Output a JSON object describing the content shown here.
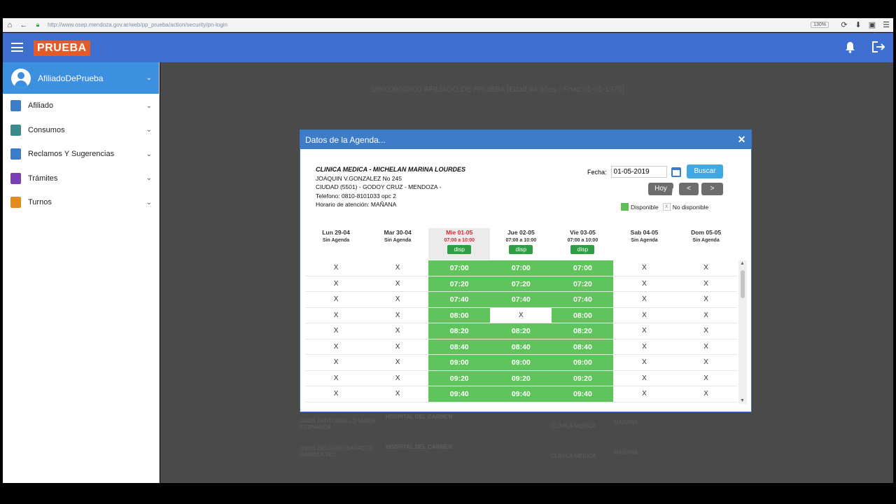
{
  "browser": {
    "url": "http://www.osep.mendoza.gov.ar/web/pp_prueba/action/security/pn-login",
    "zoom": "130%"
  },
  "header": {
    "brand": "PRUEBA"
  },
  "sidebar": {
    "user": "AfiliadoDePrueba",
    "items": [
      {
        "label": "Afiliado",
        "color": "#3d7cc9"
      },
      {
        "label": "Consumos",
        "color": "#3a8a8a"
      },
      {
        "label": "Reclamos Y Sugerencias",
        "color": "#3d7cc9"
      },
      {
        "label": "Trámites",
        "color": "#7b3fb5"
      },
      {
        "label": "Turnos",
        "color": "#e58a1f"
      }
    ]
  },
  "background": {
    "affiliate_line": "5/00000000/00 AFILIADO DE PRUEBA [Edad:44 años - Fnac:01-01-1975]",
    "rows": [
      {
        "doctor": "04485 PANTORRILLO MARIA FERNANDA",
        "place": "HOSPITAL DEL CARMEN",
        "spec": "CLINICA MEDICA",
        "shift": "MAÑANA"
      },
      {
        "doctor": "09565 DELGADO BARRETO DANIELA DEL",
        "place": "HOSPITAL DEL CARMEN",
        "spec": "CLINICA MEDICA",
        "shift": "MAÑANA"
      }
    ]
  },
  "modal": {
    "title": "Datos de la Agenda...",
    "clinic": {
      "name": "CLINICA MEDICA - MICHELAN MARINA LOURDES",
      "address": "JOAQUIN V.GONZALEZ No 245",
      "city": "CIUDAD (5501) - GODOY CRUZ - MENDOZA -",
      "phone": "Telefono: 0810-8101033 opc 2",
      "hours": "Horario de atención: MAÑANA"
    },
    "fecha_label": "Fecha:",
    "fecha_value": "01-05-2019",
    "buscar": "Buscar",
    "hoy": "Hoy",
    "prev": "<",
    "next": ">",
    "legend_available": "Disponible",
    "legend_unavailable": "No disponible",
    "legend_x": "X",
    "days": [
      {
        "name": "Lun 29-04",
        "sub": "Sin Agenda",
        "disp": "",
        "today": false
      },
      {
        "name": "Mar 30-04",
        "sub": "Sin Agenda",
        "disp": "",
        "today": false
      },
      {
        "name": "Mie 01-05",
        "sub": "07:00 a 10:00",
        "disp": "disp",
        "today": true
      },
      {
        "name": "Jue 02-05",
        "sub": "07:00 a 10:00",
        "disp": "disp",
        "today": false
      },
      {
        "name": "Vie 03-05",
        "sub": "07:00 a 10:00",
        "disp": "disp",
        "today": false
      },
      {
        "name": "Sab 04-05",
        "sub": "Sin Agenda",
        "disp": "",
        "today": false
      },
      {
        "name": "Dom 05-05",
        "sub": "Sin Agenda",
        "disp": "",
        "today": false
      }
    ],
    "slots": [
      [
        "X",
        "X",
        "07:00",
        "07:00",
        "07:00",
        "X",
        "X"
      ],
      [
        "X",
        "X",
        "07:20",
        "07:20",
        "07:20",
        "X",
        "X"
      ],
      [
        "X",
        "X",
        "07:40",
        "07:40",
        "07:40",
        "X",
        "X"
      ],
      [
        "X",
        "X",
        "08:00",
        "X",
        "08:00",
        "X",
        "X"
      ],
      [
        "X",
        "X",
        "08:20",
        "08:20",
        "08:20",
        "X",
        "X"
      ],
      [
        "X",
        "X",
        "08:40",
        "08:40",
        "08:40",
        "X",
        "X"
      ],
      [
        "X",
        "X",
        "09:00",
        "09:00",
        "09:00",
        "X",
        "X"
      ],
      [
        "X",
        "X",
        "09:20",
        "09:20",
        "09:20",
        "X",
        "X"
      ],
      [
        "X",
        "X",
        "09:40",
        "09:40",
        "09:40",
        "X",
        "X"
      ]
    ]
  }
}
